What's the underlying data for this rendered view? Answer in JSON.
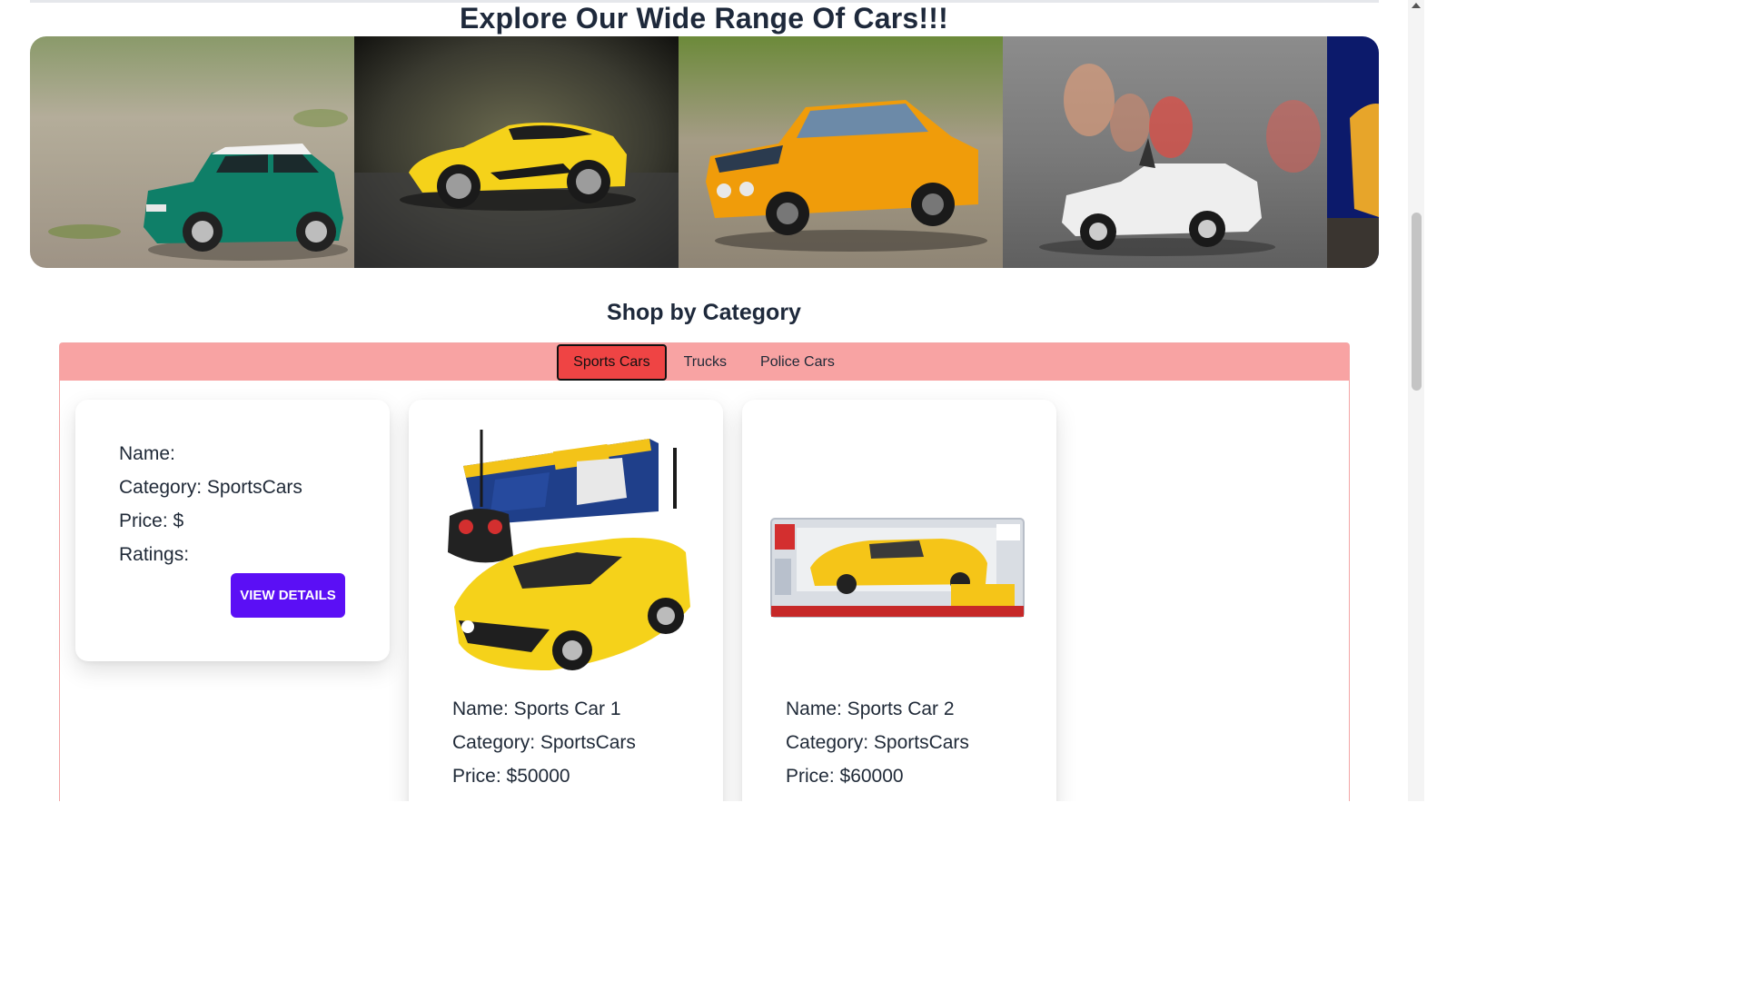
{
  "hero": {
    "title": "Explore Our Wide Range Of Cars!!!"
  },
  "gallery": {
    "slides": [
      "green-mini-car",
      "yellow-sports-car",
      "orange-classic-car",
      "white-roadster",
      "partial-slide"
    ]
  },
  "category": {
    "title": "Shop by Category",
    "tabs": [
      {
        "label": "Sports Cars",
        "active": true
      },
      {
        "label": "Trucks",
        "active": false
      },
      {
        "label": "Police Cars",
        "active": false
      }
    ],
    "active_color": "#ef4444",
    "bar_color": "#f8a3a3"
  },
  "products": [
    {
      "name_line": "Name:",
      "category_line": "Category: SportsCars",
      "price_line": "Price: $",
      "ratings_line": "Ratings:",
      "button_label": "VIEW DETAILS"
    },
    {
      "name_line": "Name: Sports Car 1",
      "category_line": "Category: SportsCars",
      "price_line": "Price: $50000"
    },
    {
      "name_line": "Name: Sports Car 2",
      "category_line": "Category: SportsCars",
      "price_line": "Price: $60000"
    }
  ],
  "colors": {
    "button": "#5b0ff5"
  }
}
